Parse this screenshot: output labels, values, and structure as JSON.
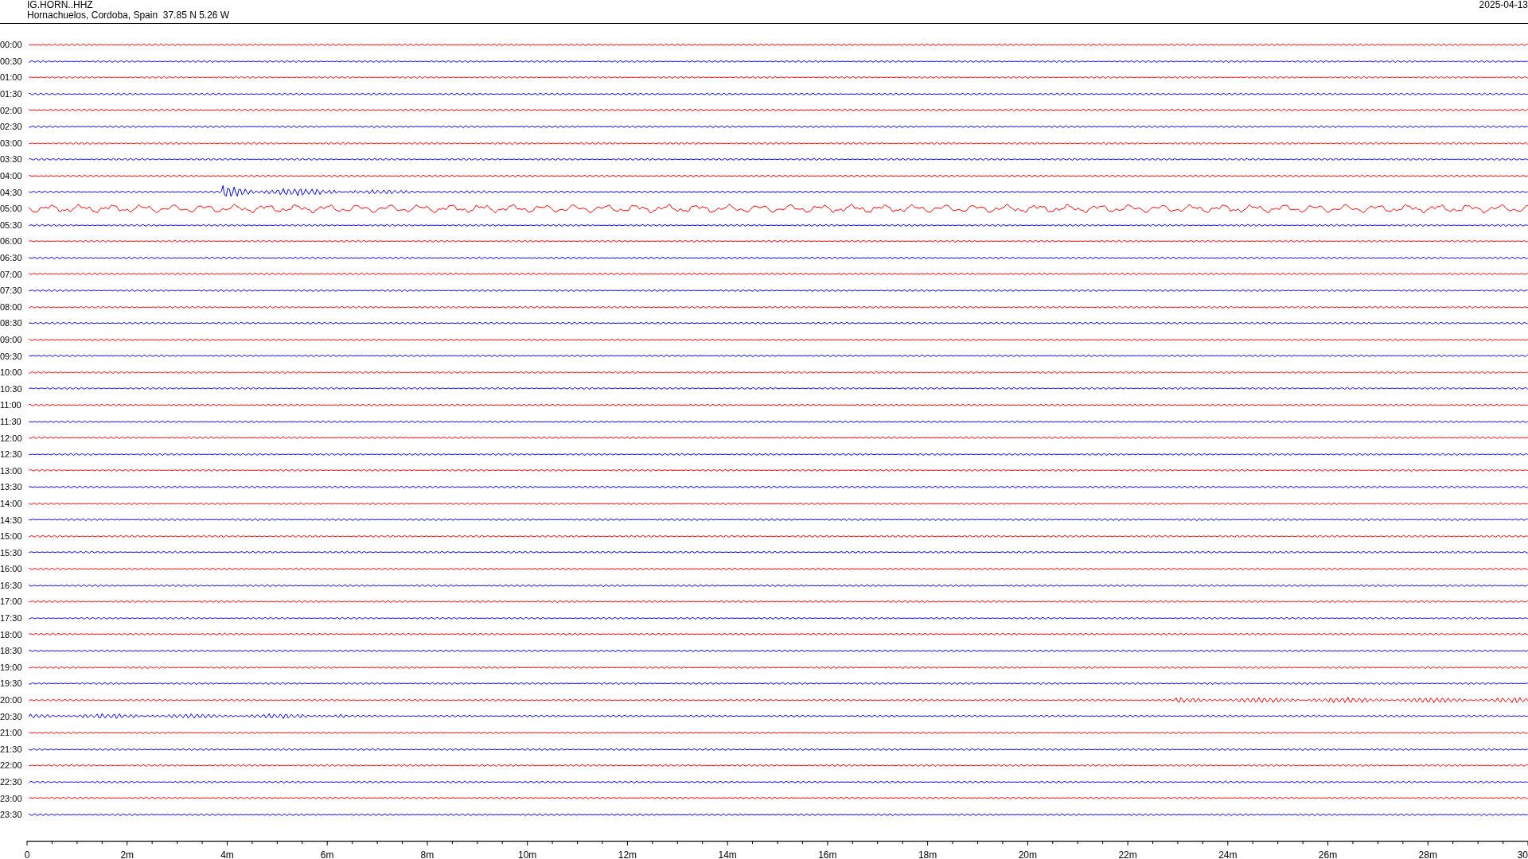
{
  "header": {
    "station": "IG.HORN..HHZ",
    "location": "Hornachuelos, Cordoba, Spain  37.85 N 5.26 W",
    "date": "2025-04-13"
  },
  "rows": [
    {
      "time": "00:00",
      "color": "#ff0000"
    },
    {
      "time": "00:30",
      "color": "#0000ff"
    },
    {
      "time": "01:00",
      "color": "#ff0000"
    },
    {
      "time": "01:30",
      "color": "#0000ff"
    },
    {
      "time": "02:00",
      "color": "#ff0000"
    },
    {
      "time": "02:30",
      "color": "#0000ff"
    },
    {
      "time": "03:00",
      "color": "#ff0000"
    },
    {
      "time": "03:30",
      "color": "#0000ff"
    },
    {
      "time": "04:00",
      "color": "#ff0000"
    },
    {
      "time": "04:30",
      "color": "#0000ff"
    },
    {
      "time": "05:00",
      "color": "#ff0000"
    },
    {
      "time": "05:30",
      "color": "#0000ff"
    },
    {
      "time": "06:00",
      "color": "#ff0000"
    },
    {
      "time": "06:30",
      "color": "#0000ff"
    },
    {
      "time": "07:00",
      "color": "#ff0000"
    },
    {
      "time": "07:30",
      "color": "#0000ff"
    },
    {
      "time": "08:00",
      "color": "#ff0000"
    },
    {
      "time": "08:30",
      "color": "#0000ff"
    },
    {
      "time": "09:00",
      "color": "#ff0000"
    },
    {
      "time": "09:30",
      "color": "#0000ff"
    },
    {
      "time": "10:00",
      "color": "#ff0000"
    },
    {
      "time": "10:30",
      "color": "#0000ff"
    },
    {
      "time": "11:00",
      "color": "#ff0000"
    },
    {
      "time": "11:30",
      "color": "#0000ff"
    },
    {
      "time": "12:00",
      "color": "#ff0000"
    },
    {
      "time": "12:30",
      "color": "#0000ff"
    },
    {
      "time": "13:00",
      "color": "#ff0000"
    },
    {
      "time": "13:30",
      "color": "#0000ff"
    },
    {
      "time": "14:00",
      "color": "#ff0000"
    },
    {
      "time": "14:30",
      "color": "#0000ff"
    },
    {
      "time": "15:00",
      "color": "#ff0000"
    },
    {
      "time": "15:30",
      "color": "#0000ff"
    },
    {
      "time": "16:00",
      "color": "#ff0000"
    },
    {
      "time": "16:30",
      "color": "#0000ff"
    },
    {
      "time": "17:00",
      "color": "#ff0000"
    },
    {
      "time": "17:30",
      "color": "#0000ff"
    },
    {
      "time": "18:00",
      "color": "#ff0000"
    },
    {
      "time": "18:30",
      "color": "#0000ff"
    },
    {
      "time": "19:00",
      "color": "#ff0000"
    },
    {
      "time": "19:30",
      "color": "#0000ff"
    },
    {
      "time": "20:00",
      "color": "#ff0000"
    },
    {
      "time": "20:30",
      "color": "#0000ff"
    },
    {
      "time": "21:00",
      "color": "#ff0000"
    },
    {
      "time": "21:30",
      "color": "#0000ff"
    },
    {
      "time": "22:00",
      "color": "#ff0000"
    },
    {
      "time": "22:30",
      "color": "#0000ff"
    },
    {
      "time": "23:00",
      "color": "#ff0000"
    },
    {
      "time": "23:30",
      "color": "#0000ff"
    }
  ],
  "axis": {
    "ticks": [
      "0",
      "2m",
      "4m",
      "6m",
      "8m",
      "10m",
      "12m",
      "14m",
      "16m",
      "18m",
      "20m",
      "22m",
      "24m",
      "26m",
      "28m",
      "30"
    ]
  }
}
